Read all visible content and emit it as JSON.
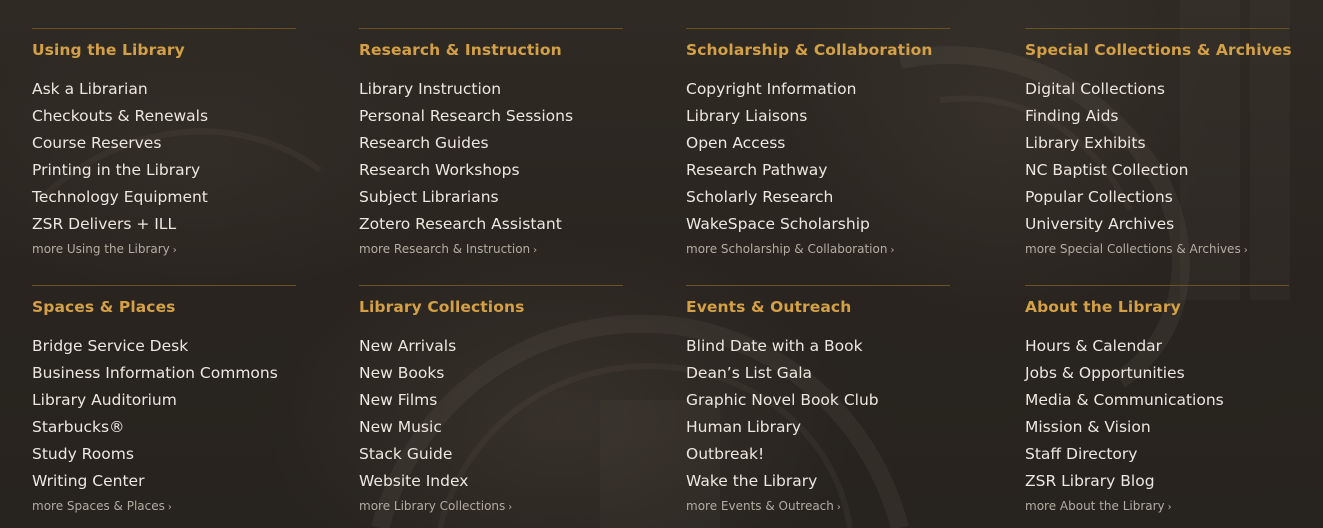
{
  "columns": [
    {
      "heading": "Using the Library",
      "links": [
        "Ask a Librarian",
        "Checkouts & Renewals",
        "Course Reserves",
        "Printing in the Library",
        "Technology Equipment",
        "ZSR Delivers + ILL"
      ],
      "more": "more Using the Library"
    },
    {
      "heading": "Research & Instruction",
      "links": [
        "Library Instruction",
        "Personal Research Sessions",
        "Research Guides",
        "Research Workshops",
        "Subject Librarians",
        "Zotero Research Assistant"
      ],
      "more": "more Research & Instruction"
    },
    {
      "heading": "Scholarship & Collaboration",
      "links": [
        "Copyright Information",
        "Library Liaisons",
        "Open Access",
        "Research Pathway",
        "Scholarly Research",
        "WakeSpace Scholarship"
      ],
      "more": "more Scholarship & Collaboration"
    },
    {
      "heading": "Special Collections & Archives",
      "links": [
        "Digital Collections",
        "Finding Aids",
        "Library Exhibits",
        "NC Baptist Collection",
        "Popular Collections",
        "University Archives"
      ],
      "more": "more Special Collections & Archives"
    },
    {
      "heading": "Spaces & Places",
      "links": [
        "Bridge Service Desk",
        "Business Information Commons",
        "Library Auditorium",
        "Starbucks®",
        "Study Rooms",
        "Writing Center"
      ],
      "more": "more Spaces & Places"
    },
    {
      "heading": "Library Collections",
      "links": [
        "New Arrivals",
        "New Books",
        "New Films",
        "New Music",
        "Stack Guide",
        "Website Index"
      ],
      "more": "more Library Collections"
    },
    {
      "heading": "Events & Outreach",
      "links": [
        "Blind Date with a Book",
        "Dean’s List Gala",
        "Graphic Novel Book Club",
        "Human Library",
        "Outbreak!",
        "Wake the Library"
      ],
      "more": "more Events & Outreach"
    },
    {
      "heading": "About the Library",
      "links": [
        "Hours & Calendar",
        "Jobs & Opportunities",
        "Media & Communications",
        "Mission & Vision",
        "Staff Directory",
        "ZSR Library Blog"
      ],
      "more": "more About the Library"
    }
  ],
  "more_chevron": "›",
  "colors": {
    "heading": "#d4a046",
    "link": "#ece7df",
    "more": "#b3aca2",
    "rule": "#6b5227",
    "background": "#2b2620"
  }
}
